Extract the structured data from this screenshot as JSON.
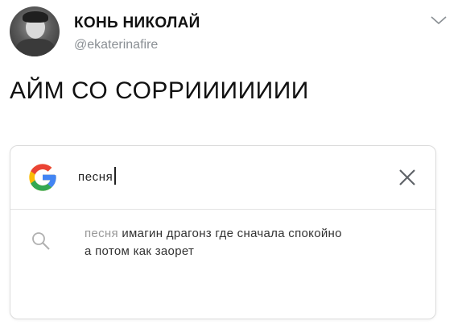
{
  "tweet": {
    "author": {
      "display_name": "КОНЬ НИКОЛАЙ",
      "handle": "@ekaterinafire"
    },
    "text": "АЙМ СО СОРРИИИИИИИ",
    "menu_icon": "chevron-down-icon"
  },
  "search": {
    "query": "песня",
    "clear_icon": "close-icon",
    "logo": "google-g-logo",
    "suggestion": {
      "icon": "search-icon",
      "match": "песня",
      "rest_line1": " имагин драгонз где сначала спокойно",
      "line2": "а потом как заорет"
    }
  },
  "colors": {
    "handle": "#8a8f94",
    "border": "#dcdcdc",
    "google_blue": "#4285f4",
    "google_red": "#ea4335",
    "google_yellow": "#fbbc05",
    "google_green": "#34a853"
  }
}
